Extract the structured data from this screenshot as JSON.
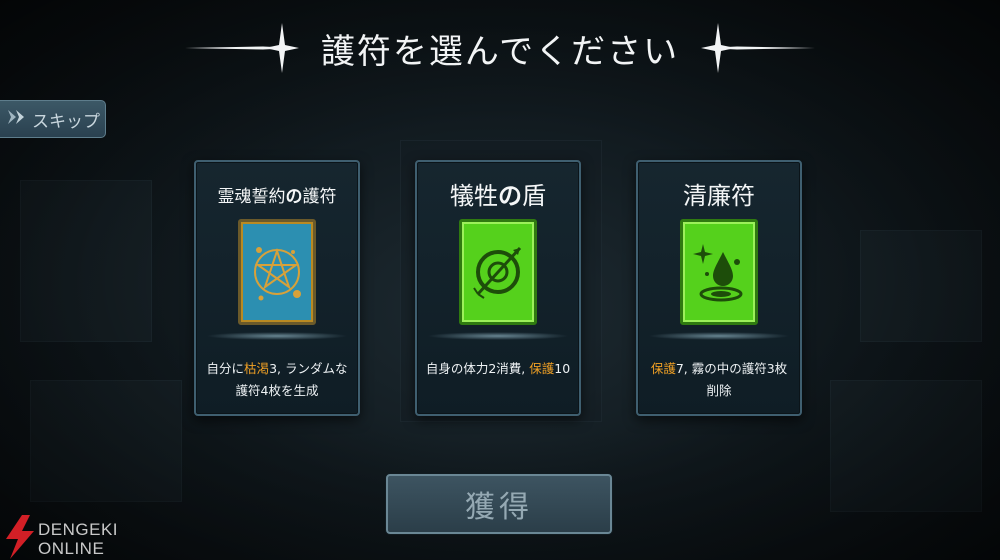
{
  "header": {
    "title": "護符を選んでください"
  },
  "skip_button": {
    "label": "スキップ",
    "icon": "double-chevron-right-icon"
  },
  "cards": [
    {
      "name_main": "霊魂誓約",
      "name_particle": "の",
      "name_tail": "護符",
      "art_icon": "pentagram-icon",
      "art_color": "#2c8fb1",
      "desc_parts": [
        "自分に",
        "枯渇",
        "3, ランダムな護符4枚を生成"
      ]
    },
    {
      "name_main": "犠牲",
      "name_particle": "の",
      "name_tail": "盾",
      "art_icon": "shield-arrow-icon",
      "art_color": "#55d11c",
      "desc_parts": [
        "自身の体力2消費, ",
        "保護",
        "10"
      ]
    },
    {
      "name_main": "清廉符",
      "name_particle": "",
      "name_tail": "",
      "art_icon": "water-drop-sparkle-icon",
      "art_color": "#55d11c",
      "desc_parts": [
        "",
        "保護",
        "7, 霧の中の護符3枚削除"
      ]
    }
  ],
  "acquire_button": {
    "label": "獲得"
  },
  "watermark": {
    "line1": "DENGEKI",
    "line2": "ONLINE"
  },
  "colors": {
    "highlight": "#f0a024",
    "background": "#111a1f"
  }
}
